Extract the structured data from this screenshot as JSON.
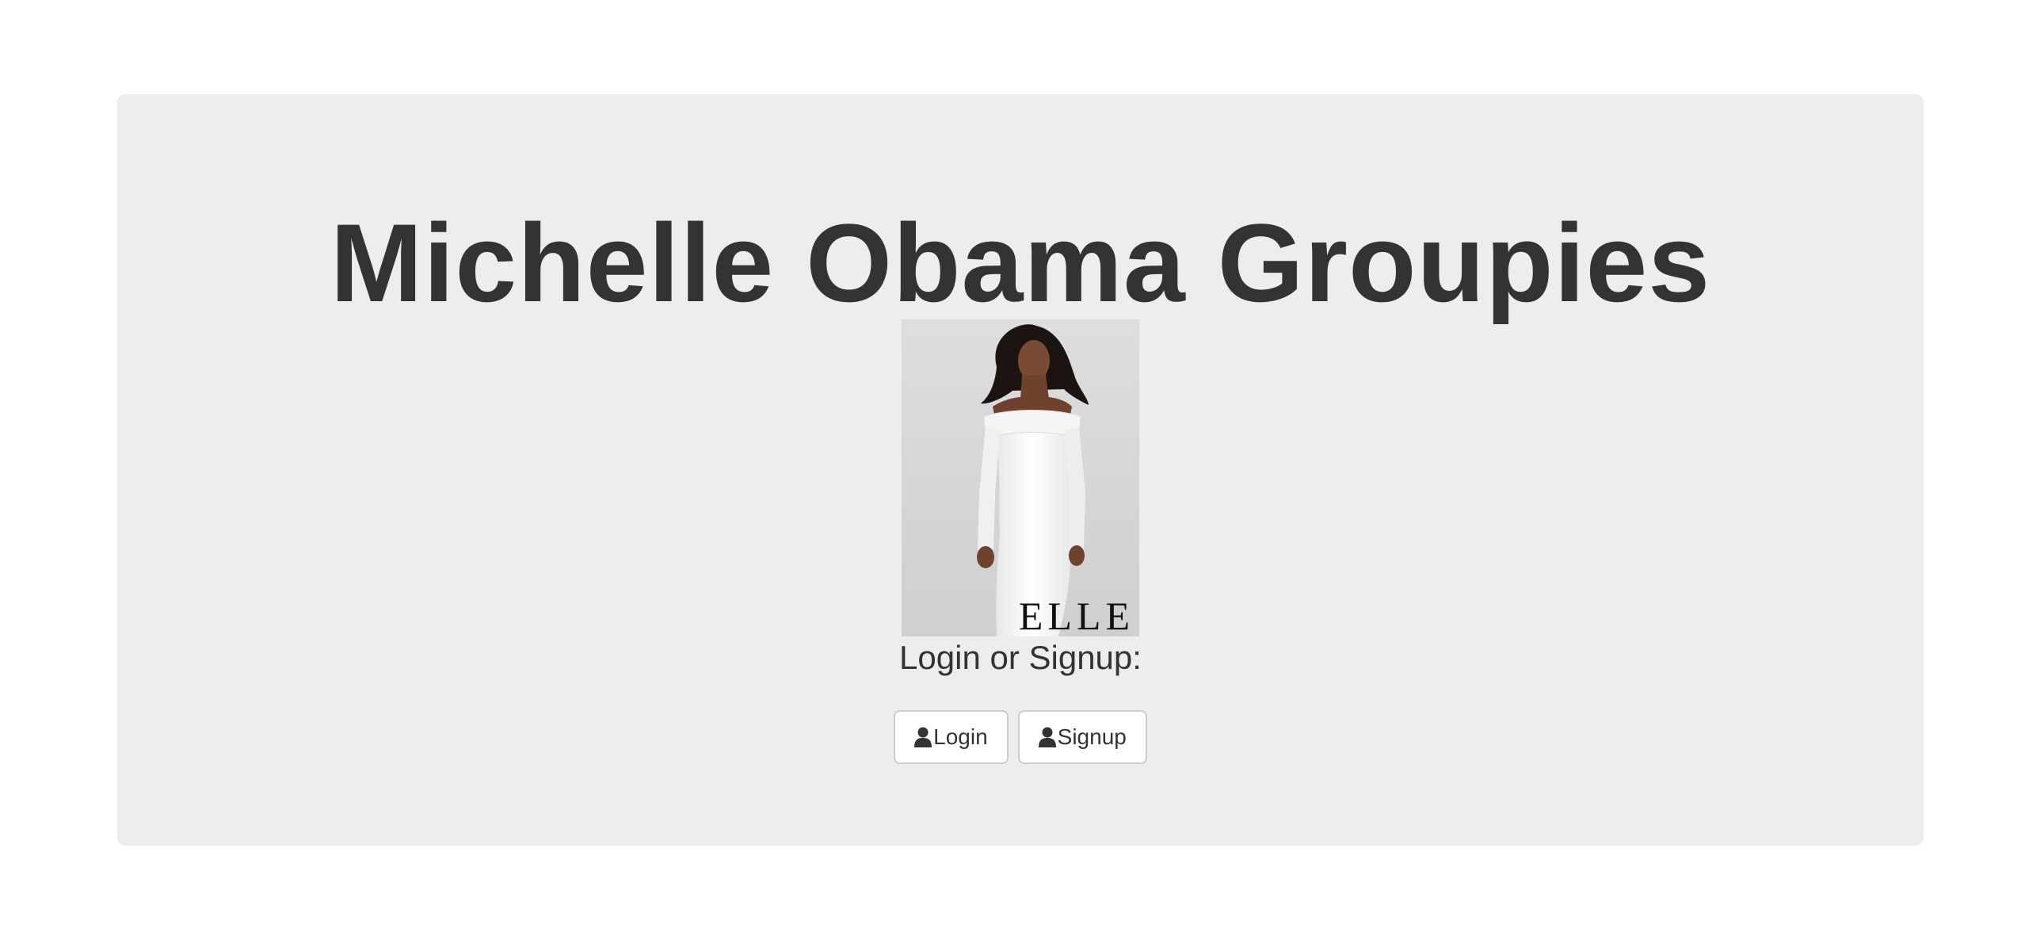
{
  "header": {
    "title": "Michelle Obama Groupies"
  },
  "cover": {
    "magazine": "ELLE",
    "alt": "Michelle Obama on ELLE cover"
  },
  "auth": {
    "prompt": "Login or Signup:",
    "login_label": "Login",
    "signup_label": "Signup",
    "icon": "user-icon"
  },
  "colors": {
    "panel_bg": "#ededed",
    "text": "#333333",
    "button_border": "#cccccc"
  }
}
